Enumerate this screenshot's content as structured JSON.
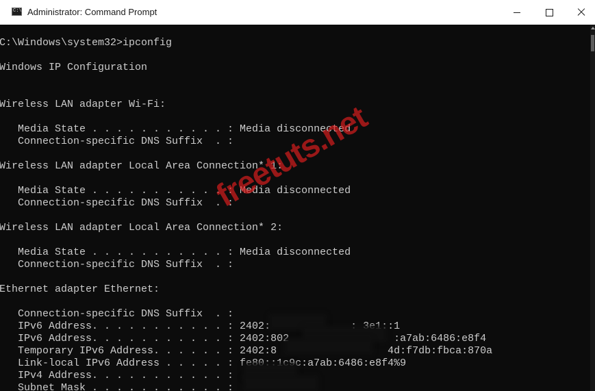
{
  "window": {
    "title": "Administrator: Command Prompt",
    "icon_label": "C:\\",
    "controls": [
      {
        "name": "minimize",
        "icon": "minimize-icon"
      },
      {
        "name": "maximize",
        "icon": "maximize-icon"
      },
      {
        "name": "close",
        "icon": "close-icon"
      }
    ]
  },
  "console": {
    "background": "#0c0c0c",
    "text_color": "#cccccc",
    "lines": [
      "C:\\Windows\\system32>ipconfig",
      "Windows IP Configuration",
      "Wireless LAN adapter Wi-Fi:",
      "   Media State . . . . . . . . . . . : Media disconnected",
      "   Connection-specific DNS Suffix  . :",
      "Wireless LAN adapter Local Area Connection* 1:",
      "   Media State . . . . . . . . . . . : Media disconnected",
      "   Connection-specific DNS Suffix  . :",
      "Wireless LAN adapter Local Area Connection* 2:",
      "   Media State . . . . . . . . . . . : Media disconnected",
      "   Connection-specific DNS Suffix  . :",
      "Ethernet adapter Ethernet:",
      "   Connection-specific DNS Suffix  . :",
      "   IPv6 Address. . . . . . . . . . . : 2402:             : 3e1::1",
      "   IPv6 Address. . . . . . . . . . . : 2402:802                 :a7ab:6486:e8f4",
      "   Temporary IPv6 Address. . . . . . : 2402:8                  4d:f7db:fbca:870a",
      "   Link-local IPv6 Address . . . . . : fe80::1c9c:a7ab:6486:e8f4%9",
      "   IPv4 Address. . . . . . . . . . . :",
      "   Subnet Mask . . . . . . . . . . . :"
    ]
  },
  "watermark": {
    "text": "freetuts.net",
    "color": "#d61e1e"
  }
}
